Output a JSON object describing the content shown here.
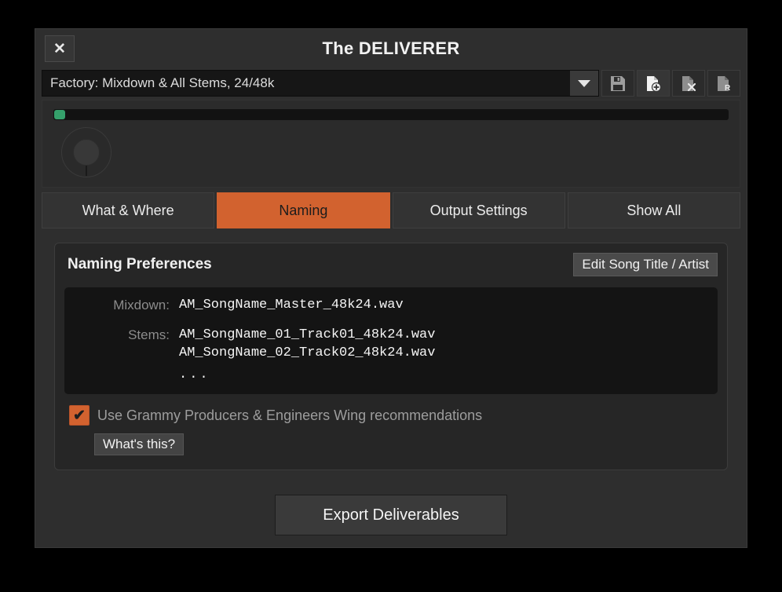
{
  "window": {
    "title": "The DELIVERER",
    "close_label": "✕"
  },
  "preset": {
    "value": "Factory: Mixdown & All Stems, 24/48k",
    "dropdown_icon": "chevron-down-icon",
    "actions": [
      {
        "name": "save-preset",
        "icon": "floppy-disk-icon"
      },
      {
        "name": "new-preset",
        "icon": "file-plus-icon"
      },
      {
        "name": "delete-preset",
        "icon": "file-x-icon"
      },
      {
        "name": "rename-preset",
        "icon": "file-rename-icon"
      }
    ]
  },
  "transport": {
    "progress_percent": 0,
    "progress_fill_color": "#35a06b",
    "knob_value_label": ""
  },
  "tabs": [
    {
      "label": "What & Where",
      "active": false
    },
    {
      "label": "Naming",
      "active": true
    },
    {
      "label": "Output Settings",
      "active": false
    },
    {
      "label": "Show All",
      "active": false
    }
  ],
  "panel": {
    "title": "Naming Preferences",
    "edit_button_label": "Edit Song Title / Artist",
    "preview": {
      "mixdown_label": "Mixdown:",
      "mixdown_value": "AM_SongName_Master_48k24.wav",
      "stems_label": "Stems:",
      "stems_values": [
        "AM_SongName_01_Track01_48k24.wav",
        "AM_SongName_02_Track02_48k24.wav"
      ],
      "stems_more": "..."
    },
    "checkbox": {
      "checked": true,
      "mark": "✔",
      "label": "Use Grammy Producers & Engineers Wing recommendations",
      "accent_color": "#d2622f"
    },
    "whats_this_label": "What's this?"
  },
  "footer": {
    "export_label": "Export Deliverables"
  },
  "theme": {
    "accent": "#d2622f",
    "window_bg": "#2e2e2e",
    "panel_bg": "#262626",
    "preview_bg": "#141414",
    "progress_green": "#35a06b"
  }
}
